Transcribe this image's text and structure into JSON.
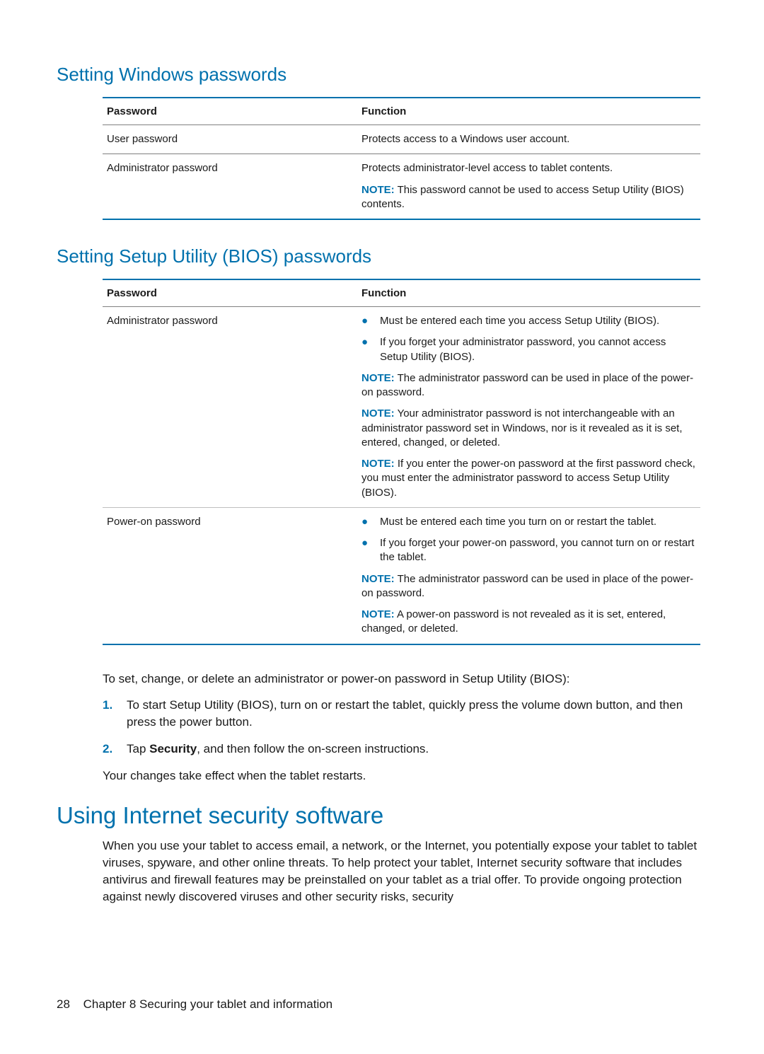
{
  "heading1": "Setting Windows passwords",
  "table1": {
    "header": {
      "c1": "Password",
      "c2": "Function"
    },
    "rows": [
      {
        "c1": "User password",
        "c2": "Protects access to a Windows user account."
      },
      {
        "c1": "Administrator password",
        "c2": "Protects administrator-level access to tablet contents.",
        "note_label": "NOTE:",
        "note_text": "This password cannot be used to access Setup Utility (BIOS) contents."
      }
    ]
  },
  "heading2": "Setting Setup Utility (BIOS) passwords",
  "table2": {
    "header": {
      "c1": "Password",
      "c2": "Function"
    },
    "row1": {
      "c1": "Administrator password",
      "b1": "Must be entered each time you access Setup Utility (BIOS).",
      "b2": "If you forget your administrator password, you cannot access Setup Utility (BIOS).",
      "n1l": "NOTE:",
      "n1t": "The administrator password can be used in place of the power-on password.",
      "n2l": "NOTE:",
      "n2t": "Your administrator password is not interchangeable with an administrator password set in Windows, nor is it revealed as it is set, entered, changed, or deleted.",
      "n3l": "NOTE:",
      "n3t": "If you enter the power-on password at the first password check, you must enter the administrator password to access Setup Utility (BIOS)."
    },
    "row2": {
      "c1": "Power-on password",
      "b1": "Must be entered each time you turn on or restart the tablet.",
      "b2": "If you forget your power-on password, you cannot turn on or restart the tablet.",
      "n1l": "NOTE:",
      "n1t": "The administrator password can be used in place of the power-on password.",
      "n2l": "NOTE:",
      "n2t": "A power-on password is not revealed as it is set, entered, changed, or deleted."
    }
  },
  "instructions": {
    "intro": "To set, change, or delete an administrator or power-on password in Setup Utility (BIOS):",
    "step1_num": "1.",
    "step1": "To start Setup Utility (BIOS), turn on or restart the tablet, quickly press the volume down button, and then press the power button.",
    "step2_num": "2.",
    "step2_a": "Tap ",
    "step2_bold": "Security",
    "step2_b": ", and then follow the on-screen instructions.",
    "outro": "Your changes take effect when the tablet restarts."
  },
  "heading3": "Using Internet security software",
  "para1": "When you use your tablet to access email, a network, or the Internet, you potentially expose your tablet to tablet viruses, spyware, and other online threats. To help protect your tablet, Internet security software that includes antivirus and firewall features may be preinstalled on your tablet as a trial offer. To provide ongoing protection against newly discovered viruses and other security risks, security",
  "footer": {
    "page": "28",
    "chapter": "Chapter 8   Securing your tablet and information"
  }
}
